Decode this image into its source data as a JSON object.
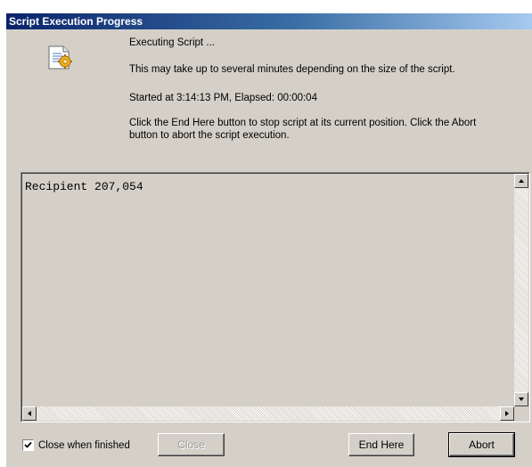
{
  "window": {
    "title": "Script Execution Progress"
  },
  "messages": {
    "executing": "Executing Script ...",
    "duration_note": "This may take up to several minutes depending on the size of the script.",
    "status": "Started at 3:14:13 PM, Elapsed: 00:00:04",
    "instructions": "Click the End Here button to stop script at its current position. Click the Abort button to abort the script execution."
  },
  "output": {
    "text": "Recipient 207,054"
  },
  "footer": {
    "close_when_finished_label": "Close when finished",
    "close_when_finished_checked": true,
    "close_label": "Close",
    "end_here_label": "End Here",
    "abort_label": "Abort"
  },
  "icons": {
    "script": "script-gear-icon"
  },
  "colors": {
    "dialog_bg": "#d4d0c8",
    "titlebar_start": "#0a246a",
    "titlebar_end": "#a6caf0"
  }
}
